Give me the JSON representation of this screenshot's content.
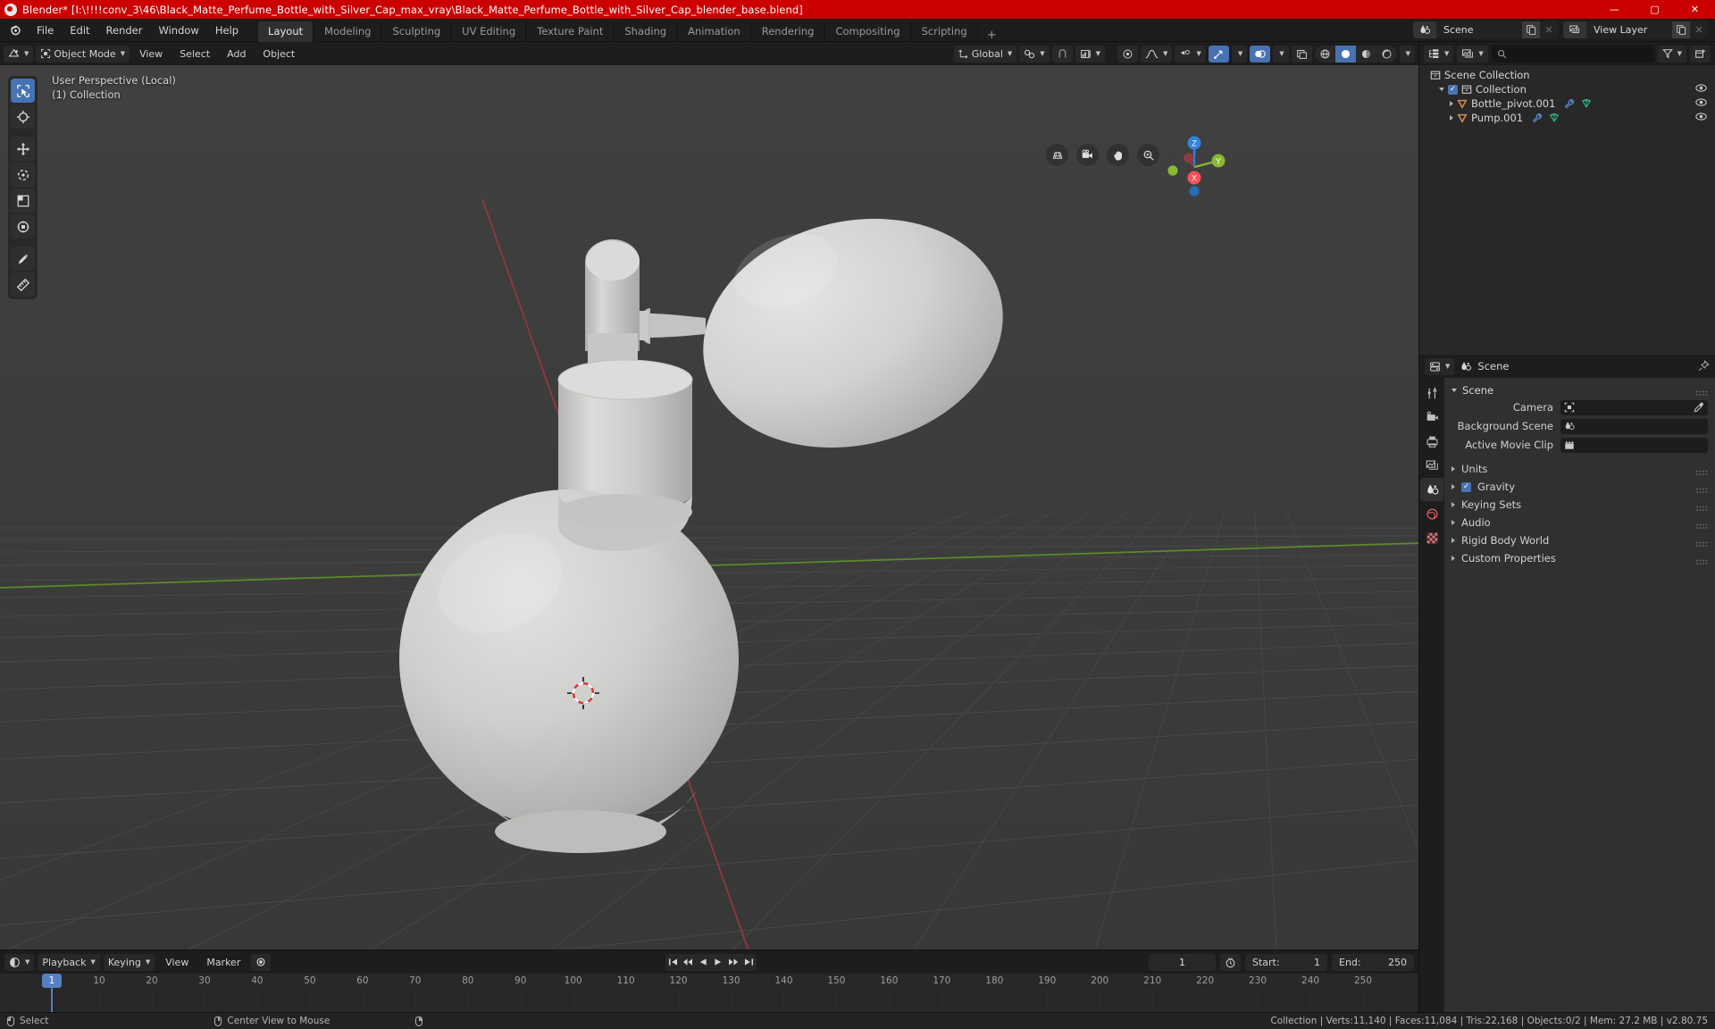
{
  "titlebar": {
    "app": "Blender*",
    "title": "Blender* [I:\\!!!!conv_3\\46\\Black_Matte_Perfume_Bottle_with_Silver_Cap_max_vray\\Black_Matte_Perfume_Bottle_with_Silver_Cap_blender_base.blend]",
    "minimize": "—",
    "maximize": "▢",
    "close": "✕",
    "accent_color": "#cc0000"
  },
  "topbar": {
    "menus": [
      "File",
      "Edit",
      "Render",
      "Window",
      "Help"
    ],
    "workspaces": [
      {
        "label": "Layout",
        "active": true
      },
      {
        "label": "Modeling",
        "active": false
      },
      {
        "label": "Sculpting",
        "active": false
      },
      {
        "label": "UV Editing",
        "active": false
      },
      {
        "label": "Texture Paint",
        "active": false
      },
      {
        "label": "Shading",
        "active": false
      },
      {
        "label": "Animation",
        "active": false
      },
      {
        "label": "Rendering",
        "active": false
      },
      {
        "label": "Compositing",
        "active": false
      },
      {
        "label": "Scripting",
        "active": false
      }
    ],
    "add_workspace": "+",
    "scene_name": "Scene",
    "view_layer_name": "View Layer"
  },
  "viewport_header": {
    "editor_type": "editor-type-3dview",
    "mode": "Object Mode",
    "menus": [
      "View",
      "Select",
      "Add",
      "Object"
    ],
    "transform_orientation": "Global",
    "snap_enabled": false,
    "proportional_editing": false
  },
  "viewport": {
    "overlay_line1": "User Perspective (Local)",
    "overlay_line2": "(1) Collection",
    "tools": [
      "select-box-tool",
      "cursor-tool",
      "move-tool",
      "rotate-tool",
      "scale-tool",
      "transform-tool",
      "annotate-tool",
      "measure-tool"
    ],
    "nav_icons": [
      "toggle-camera-perspective-icon",
      "camera-view-icon",
      "pan-view-icon",
      "zoom-view-icon"
    ],
    "axis_labels": {
      "x": "X",
      "y": "Y",
      "z": "Z"
    },
    "axis_colors": {
      "x": "#fc4f5a",
      "y": "#8bb832",
      "z": "#2f83e3"
    }
  },
  "outliner": {
    "display_mode": "view-layer",
    "search_placeholder": "",
    "rows": [
      {
        "label": "Scene Collection",
        "icon": "collection-icon",
        "indent": 0,
        "has_disclosure": false,
        "has_checkbox": false,
        "has_eye": false
      },
      {
        "label": "Collection",
        "icon": "collection-icon",
        "indent": 1,
        "has_disclosure": true,
        "has_checkbox": true,
        "has_eye": true
      },
      {
        "label": "Bottle_pivot.001",
        "icon": "mesh-object-icon",
        "indent": 2,
        "has_disclosure": true,
        "has_checkbox": false,
        "has_eye": true,
        "extra_icons": [
          "modifier-wrench-icon",
          "mesh-data-icon"
        ]
      },
      {
        "label": "Pump.001",
        "icon": "mesh-object-icon",
        "indent": 2,
        "has_disclosure": true,
        "has_checkbox": false,
        "has_eye": true,
        "extra_icons": [
          "modifier-wrench-icon",
          "mesh-data-icon"
        ]
      }
    ]
  },
  "properties": {
    "breadcrumb": "Scene",
    "tabs": [
      "tool-icon",
      "render-icon",
      "output-icon",
      "view-layer-icon",
      "scene-icon",
      "world-icon",
      "texture-icon"
    ],
    "active_tab_index": 4,
    "panel_title": "Scene",
    "fields": [
      {
        "label": "Camera",
        "value": "",
        "icon": "camera-data-icon",
        "has_eyedropper": true
      },
      {
        "label": "Background Scene",
        "value": "",
        "icon": "scene-icon",
        "has_eyedropper": false
      },
      {
        "label": "Active Movie Clip",
        "value": "",
        "icon": "movie-clip-icon",
        "has_eyedropper": false
      }
    ],
    "collapsed_panels": [
      {
        "label": "Units",
        "checkbox": false
      },
      {
        "label": "Gravity",
        "checkbox": true
      },
      {
        "label": "Keying Sets",
        "checkbox": false
      },
      {
        "label": "Audio",
        "checkbox": false
      },
      {
        "label": "Rigid Body World",
        "checkbox": false
      },
      {
        "label": "Custom Properties",
        "checkbox": false
      }
    ]
  },
  "timeline": {
    "menus": [
      "Playback",
      "Keying",
      "View",
      "Marker"
    ],
    "ticks": [
      10,
      20,
      30,
      40,
      50,
      60,
      70,
      80,
      90,
      100,
      110,
      120,
      130,
      140,
      150,
      160,
      170,
      180,
      190,
      200,
      210,
      220,
      230,
      240,
      250
    ],
    "current_frame": "1",
    "current_frame_field": "1",
    "start_label": "Start:",
    "start_value": "1",
    "end_label": "End:",
    "end_value": "250",
    "playback_buttons": [
      "jump-to-start",
      "jump-prev-keyframe",
      "play-reverse",
      "play",
      "jump-next-keyframe",
      "jump-to-end"
    ],
    "record_button": "auto-keying-record"
  },
  "statusbar": {
    "left_items": [
      {
        "mouse": "left",
        "label": "Select"
      },
      {
        "mouse": "middle",
        "label": "Center View to Mouse"
      },
      {
        "mouse": "right",
        "label": ""
      }
    ],
    "stats": "Collection | Verts:11,140 | Faces:11,084 | Tris:22,168 | Objects:0/2 | Mem: 27.2 MB | v2.80.75"
  }
}
